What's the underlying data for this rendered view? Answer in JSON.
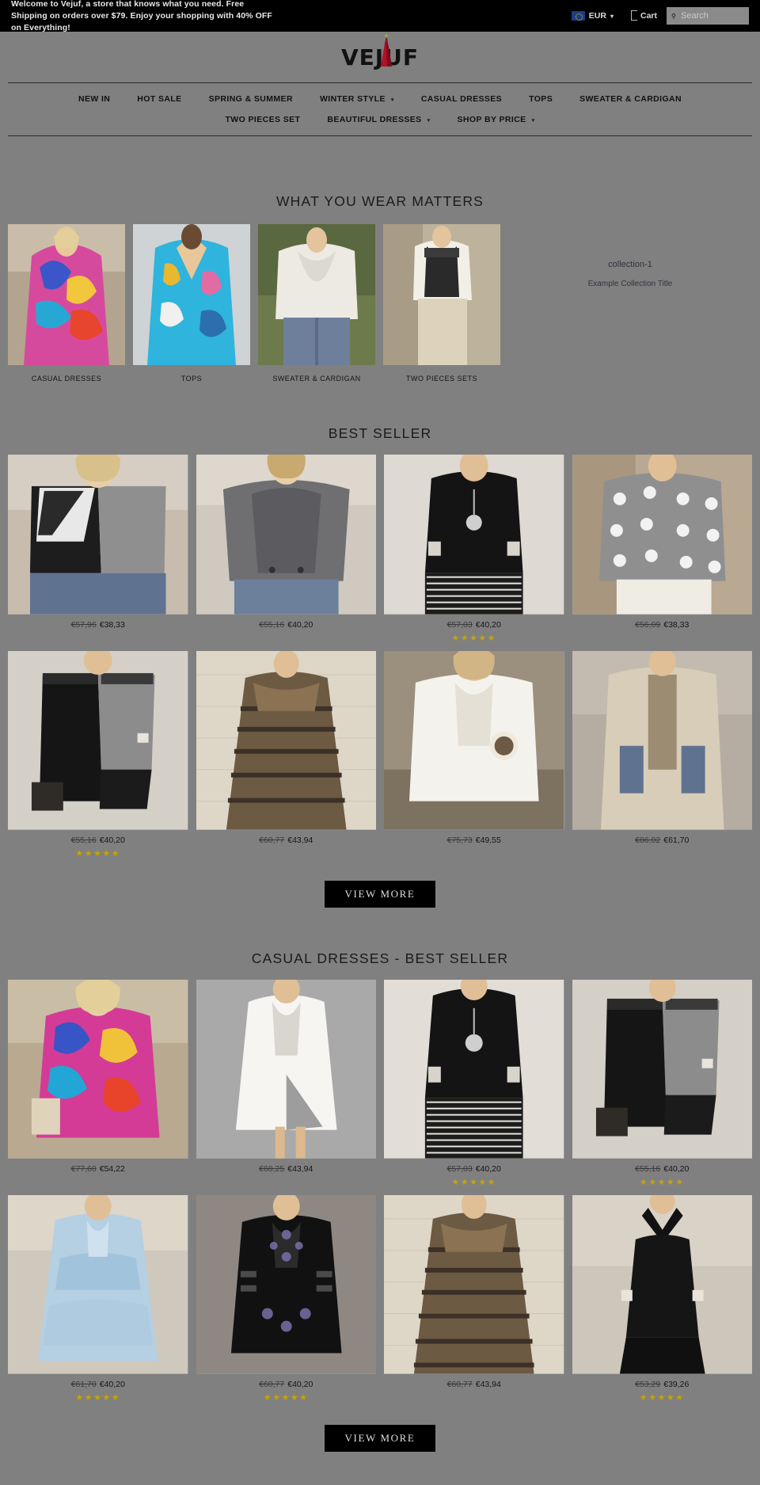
{
  "announcement": {
    "text": "Welcome to Vejuf, a store that knows what you need. Free Shipping on orders over $79. Enjoy your shopping with 40% OFF on Everything!",
    "currency_label": "EUR",
    "currency_icon": "eu-flag-icon",
    "currency_caret": "⌄",
    "cart_label": "Cart",
    "cart_icon": "cart-icon",
    "search_placeholder": "Search",
    "search_value": "",
    "search_icon": "magnifier-icon"
  },
  "brand": {
    "name": "VEJUF",
    "logo_icon": "red-dress-logo-icon"
  },
  "nav": {
    "row1": [
      {
        "label": "NEW IN",
        "caret": ""
      },
      {
        "label": "HOT SALE",
        "caret": ""
      },
      {
        "label": "SPRING & SUMMER",
        "caret": ""
      },
      {
        "label": "WINTER STYLE",
        "caret": "▾"
      },
      {
        "label": "CASUAL DRESSES",
        "caret": ""
      },
      {
        "label": "TOPS",
        "caret": ""
      },
      {
        "label": "SWEATER & CARDIGAN",
        "caret": ""
      }
    ],
    "row2": [
      {
        "label": "TWO PIECES SET",
        "caret": ""
      },
      {
        "label": "BEAUTIFUL DRESSES",
        "caret": "▾"
      },
      {
        "label": "SHOP BY PRICE",
        "caret": "▾"
      }
    ]
  },
  "collections": {
    "title": "WHAT YOU WEAR MATTERS",
    "items": [
      {
        "label": "CASUAL DRESSES",
        "art": "art-floral-dress"
      },
      {
        "label": "TOPS",
        "art": "art-blue-paisley-top"
      },
      {
        "label": "SWEATER & CARDIGAN",
        "art": "art-white-cowl-sweater"
      },
      {
        "label": "TWO PIECES SETS",
        "art": "art-beige-two-piece"
      }
    ],
    "side": {
      "handle": "collection-1",
      "title": "Example Collection Title"
    }
  },
  "best_seller": {
    "title": "BEST SELLER",
    "view_more": "VIEW MORE",
    "rows": [
      [
        {
          "art": "art-colorblock-top",
          "old": "€57,96",
          "new": "€38,33",
          "stars": 0
        },
        {
          "art": "art-grey-knit-top",
          "old": "€55,16",
          "new": "€40,20",
          "stars": 0
        },
        {
          "art": "art-black-aztec-dress",
          "old": "€57,03",
          "new": "€40,20",
          "stars": 5
        },
        {
          "art": "art-polka-dot-blouse",
          "old": "€56,09",
          "new": "€38,33",
          "stars": 0
        }
      ],
      [
        {
          "art": "art-black-grey-shift",
          "old": "€55,16",
          "new": "€40,20",
          "stars": 5
        },
        {
          "art": "art-striped-maxi",
          "old": "€60,77",
          "new": "€43,94",
          "stars": 0
        },
        {
          "art": "art-white-oversize-shirt",
          "old": "€75,73",
          "new": "€49,55",
          "stars": 0
        },
        {
          "art": "art-beige-long-cardigan",
          "old": "€86,02",
          "new": "€61,70",
          "stars": 0
        }
      ]
    ]
  },
  "casual_dresses": {
    "title": "CASUAL DRESSES - BEST SELLER",
    "view_more": "VIEW MORE",
    "rows": [
      [
        {
          "art": "art-floral-dress",
          "old": "€77,60",
          "new": "€54,22",
          "stars": 0
        },
        {
          "art": "art-white-wrap-dress",
          "old": "€68,25",
          "new": "€43,94",
          "stars": 0
        },
        {
          "art": "art-black-aztec-dress",
          "old": "€57,03",
          "new": "€40,20",
          "stars": 5
        },
        {
          "art": "art-black-grey-shift",
          "old": "€55,16",
          "new": "€40,20",
          "stars": 5
        }
      ],
      [
        {
          "art": "art-light-blue-ruffle",
          "old": "€61,70",
          "new": "€40,20",
          "stars": 5
        },
        {
          "art": "art-black-embroidered",
          "old": "€60,77",
          "new": "€40,20",
          "stars": 5
        },
        {
          "art": "art-striped-maxi",
          "old": "€60,77",
          "new": "€43,94",
          "stars": 0
        },
        {
          "art": "art-black-halter",
          "old": "€53,29",
          "new": "€39,26",
          "stars": 5
        }
      ]
    ]
  },
  "colors": {
    "page_bg": "#808080",
    "bar_bg": "#000000",
    "star": "#c7a300",
    "text": "#141414"
  }
}
